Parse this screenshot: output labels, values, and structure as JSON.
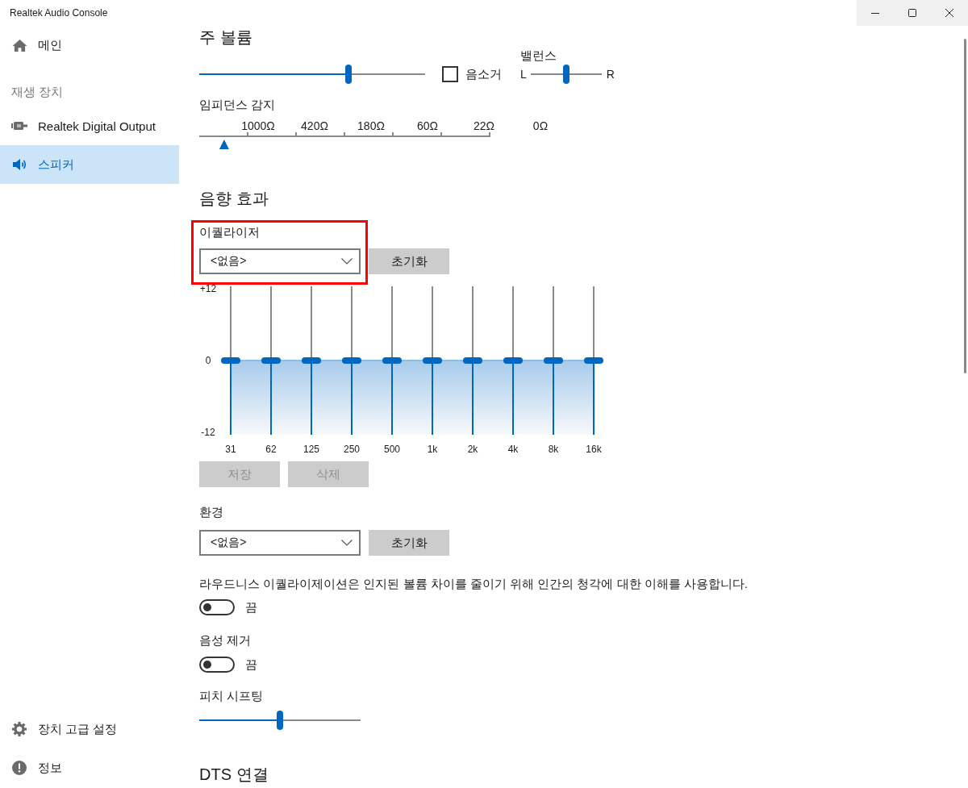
{
  "window": {
    "title": "Realtek Audio Console"
  },
  "sidebar": {
    "items": [
      {
        "label": "메인",
        "kind": "home",
        "selected": false
      }
    ],
    "section": {
      "label": "재생 장치",
      "items": [
        {
          "label": "Realtek Digital Output",
          "kind": "output",
          "selected": false
        },
        {
          "label": "스피커",
          "kind": "speaker",
          "selected": true
        }
      ]
    },
    "footer_items": [
      {
        "label": "장치 고급 설정",
        "kind": "settings",
        "selected": false
      },
      {
        "label": "정보",
        "kind": "info",
        "selected": false
      }
    ]
  },
  "main_volume": {
    "title": "주 볼륨",
    "level": 0.66,
    "mute": {
      "label": "음소거",
      "checked": false
    },
    "balance": {
      "label": "밸런스",
      "left": "L",
      "right": "R",
      "level": 0.5
    }
  },
  "impedance": {
    "label": "임피던스 감지",
    "scale": [
      "1000Ω",
      "420Ω",
      "180Ω",
      "60Ω",
      "22Ω",
      "0Ω"
    ],
    "level": 0.083
  },
  "sound_effects": {
    "title": "음향 효과",
    "equalizer": {
      "label": "이퀄라이저",
      "highlighted": true,
      "preset": "<없음>",
      "reset_button": "초기화",
      "axis": [
        "+12",
        "0",
        "-12"
      ],
      "bands": [
        {
          "label": "31",
          "level": 0.5
        },
        {
          "label": "62",
          "level": 0.5
        },
        {
          "label": "125",
          "level": 0.5
        },
        {
          "label": "250",
          "level": 0.5
        },
        {
          "label": "500",
          "level": 0.5
        },
        {
          "label": "1k",
          "level": 0.5
        },
        {
          "label": "2k",
          "level": 0.5
        },
        {
          "label": "4k",
          "level": 0.5
        },
        {
          "label": "8k",
          "level": 0.5
        },
        {
          "label": "16k",
          "level": 0.5
        }
      ],
      "buttons": [
        {
          "label": "저장",
          "disabled": true
        },
        {
          "label": "삭제",
          "disabled": true
        }
      ]
    },
    "environment": {
      "label": "환경",
      "preset": "<없음>",
      "reset_button": "초기화"
    },
    "loudness": {
      "description": "라우드니스 이퀄라이제이션은 인지된 볼륨 차이를 줄이기 위해 인간의 청각에 대한 이해를 사용합니다.",
      "on": false,
      "state_label": "끔"
    },
    "voice_cancel": {
      "label": "음성 제거",
      "on": false,
      "state_label": "끔"
    },
    "pitch_shift": {
      "label": "피치 시프팅",
      "level": 0.5
    }
  },
  "dts": {
    "title": "DTS 연결"
  }
}
